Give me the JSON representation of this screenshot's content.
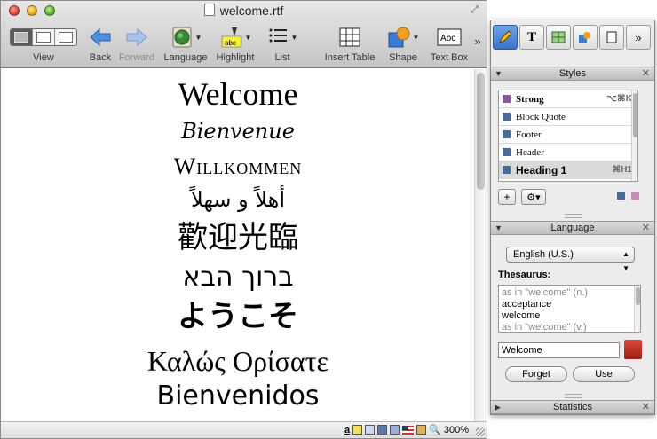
{
  "window": {
    "title": "welcome.rtf"
  },
  "toolbar": {
    "view": "View",
    "back": "Back",
    "forward": "Forward",
    "language": "Language",
    "highlight": "Highlight",
    "list": "List",
    "insert_table": "Insert Table",
    "shape": "Shape",
    "text_box": "Text Box",
    "highlight_icon_text": "abc",
    "textbox_icon_text": "Abc",
    "overflow": "»"
  },
  "document": {
    "lines": [
      "Welcome",
      "Bienvenue",
      "Willkommen",
      "أهلاً و سهلاً",
      "歡迎光臨",
      "ברוך הבא",
      "ようこそ",
      "Καλώς Ορίσατε",
      "Bienvenidos"
    ]
  },
  "status": {
    "zoom": "300%",
    "a_glyph": "a"
  },
  "inspector": {
    "tab_t": "T",
    "overflow": "»",
    "styles": {
      "title": "Styles",
      "items": [
        {
          "label": "Strong",
          "shortcut": "⌥⌘K"
        },
        {
          "label": "Block Quote",
          "shortcut": ""
        },
        {
          "label": "Footer",
          "shortcut": ""
        },
        {
          "label": "Header",
          "shortcut": ""
        },
        {
          "label": "Heading 1",
          "shortcut": "⌘H1"
        }
      ],
      "add": "+",
      "gear": "⚙▾"
    },
    "language": {
      "title": "Language",
      "selected": "English (U.S.)",
      "thesaurus_label": "Thesaurus:",
      "entries": [
        "as in \"welcome\" (n.)",
        "acceptance",
        "welcome",
        "as in \"welcome\" (v.)"
      ],
      "word": "Welcome",
      "forget": "Forget",
      "use": "Use"
    },
    "statistics": {
      "title": "Statistics"
    },
    "close": "✕",
    "tri_down": "▼",
    "tri_right": "▶"
  }
}
